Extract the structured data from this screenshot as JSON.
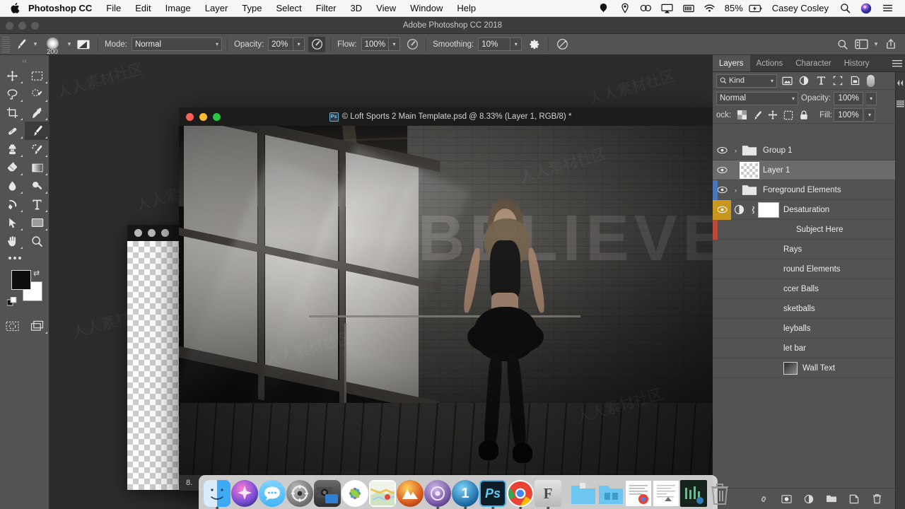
{
  "menubar": {
    "apple_icon": "apple-logo-icon",
    "app_name": "Photoshop CC",
    "items": [
      "File",
      "Edit",
      "Image",
      "Layer",
      "Type",
      "Select",
      "Filter",
      "3D",
      "View",
      "Window",
      "Help"
    ],
    "status_icons": [
      "dropbox-icon",
      "location-icon",
      "creative-cloud-icon",
      "airplay-icon",
      "battery-bar-icon",
      "wifi-icon"
    ],
    "battery": "85%",
    "battery_icon": "battery-charging-icon",
    "user": "Casey Cosley",
    "search_icon": "spotlight-search-icon",
    "siri_icon": "siri-icon",
    "notification_icon": "notification-center-icon"
  },
  "app_title": "Adobe Photoshop CC 2018",
  "optionsbar": {
    "tool_icon": "brush-tool-icon",
    "brush_size": "200",
    "brush_preset_icon": "brush-preset-picker-icon",
    "mode_label": "Mode:",
    "mode_value": "Normal",
    "opacity_label": "Opacity:",
    "opacity_value": "20%",
    "pressure_opacity_icon": "pressure-opacity-icon",
    "flow_label": "Flow:",
    "flow_value": "100%",
    "airbrush_icon": "airbrush-icon",
    "smoothing_label": "Smoothing:",
    "smoothing_value": "10%",
    "smoothing_options_icon": "gear-icon",
    "symmetry_icon": "symmetry-icon",
    "right_icons": [
      "search-icon",
      "workspace-icon",
      "chevron-down-icon",
      "share-icon"
    ]
  },
  "toolbox": {
    "tools": [
      {
        "name": "move-tool",
        "glyph": "move"
      },
      {
        "name": "marquee-tool",
        "glyph": "marquee"
      },
      {
        "name": "lasso-tool",
        "glyph": "lasso"
      },
      {
        "name": "quick-selection-tool",
        "glyph": "quickselect"
      },
      {
        "name": "crop-tool",
        "glyph": "crop"
      },
      {
        "name": "eyedropper-tool",
        "glyph": "eyedropper"
      },
      {
        "name": "healing-brush-tool",
        "glyph": "healing"
      },
      {
        "name": "brush-tool",
        "glyph": "brush",
        "selected": true
      },
      {
        "name": "clone-stamp-tool",
        "glyph": "stamp"
      },
      {
        "name": "history-brush-tool",
        "glyph": "historybrush"
      },
      {
        "name": "eraser-tool",
        "glyph": "eraser"
      },
      {
        "name": "gradient-tool",
        "glyph": "gradient"
      },
      {
        "name": "blur-tool",
        "glyph": "blur"
      },
      {
        "name": "dodge-tool",
        "glyph": "dodge"
      },
      {
        "name": "pen-tool",
        "glyph": "pen"
      },
      {
        "name": "type-tool",
        "glyph": "type"
      },
      {
        "name": "path-selection-tool",
        "glyph": "pathselect"
      },
      {
        "name": "shape-tool",
        "glyph": "shape"
      },
      {
        "name": "hand-tool",
        "glyph": "hand"
      },
      {
        "name": "zoom-tool",
        "glyph": "zoom"
      }
    ],
    "more_tools_icon": "more-tools-icon",
    "foreground_color": "#0d0d0d",
    "background_color": "#ffffff",
    "swap_colors_icon": "swap-colors-icon",
    "default_colors_icon": "default-colors-icon",
    "quick_mask_icon": "quick-mask-icon",
    "screen_mode_icon": "screen-mode-icon"
  },
  "document": {
    "title": "© Loft Sports 2 Main Template.psd @ 8.33% (Layer 1, RGB/8) *",
    "badge": "Ps",
    "zoom_status": "8.",
    "wall_text": "BELIEVE"
  },
  "background_window": {
    "traffic_lights": 3
  },
  "panels": {
    "tabs": [
      {
        "label": "Layers",
        "active": true
      },
      {
        "label": "Actions",
        "active": false
      },
      {
        "label": "Character",
        "active": false
      },
      {
        "label": "History",
        "active": false
      }
    ],
    "menu_icon": "panel-menu-icon",
    "filter": {
      "kind_label": "Kind",
      "search_icon": "search-icon",
      "chevron_icon": "chevron-down-icon",
      "type_filters": [
        "pixel-layer-filter-icon",
        "adjustment-layer-filter-icon",
        "type-layer-filter-icon",
        "shape-layer-filter-icon",
        "smart-object-filter-icon"
      ],
      "toggle_icon": "filter-toggle-switch"
    },
    "blend_mode": "Normal",
    "opacity_label": "Opacity:",
    "opacity_value": "100%",
    "lock_label": "ock:",
    "lock_icons": [
      "lock-transparent-pixels-icon",
      "lock-image-pixels-icon",
      "lock-position-icon",
      "lock-artboard-nesting-icon",
      "lock-all-icon"
    ],
    "fill_label": "Fill:",
    "fill_value": "100%",
    "layers": [
      {
        "name": "Group 1",
        "type": "group",
        "visible": true,
        "selected": false,
        "color": ""
      },
      {
        "name": "Layer 1",
        "type": "pixel",
        "visible": true,
        "selected": true,
        "color": ""
      },
      {
        "name": "Foreground Elements",
        "type": "group",
        "visible": true,
        "selected": false,
        "color": "#4a76b8"
      },
      {
        "name": "Desaturation",
        "type": "adjustment",
        "visible": true,
        "selected": false,
        "color": "#c9971f"
      },
      {
        "name": "Subject Here",
        "type": "group",
        "visible": true,
        "selected": false,
        "color": "#b94b3a"
      },
      {
        "name": "Rays",
        "type": "group",
        "visible": true,
        "selected": false,
        "color": ""
      },
      {
        "name": "round Elements",
        "type": "group",
        "visible": true,
        "selected": false,
        "color": ""
      },
      {
        "name": "ccer Balls",
        "type": "group",
        "visible": true,
        "selected": false,
        "color": ""
      },
      {
        "name": "sketballs",
        "type": "group",
        "visible": true,
        "selected": false,
        "color": ""
      },
      {
        "name": "leyballs",
        "type": "group",
        "visible": true,
        "selected": false,
        "color": ""
      },
      {
        "name": "let bar",
        "type": "group",
        "visible": true,
        "selected": false,
        "color": ""
      },
      {
        "name": "Wall Text",
        "type": "pixel",
        "visible": true,
        "selected": false,
        "color": ""
      }
    ],
    "footer_icons": [
      "link-layers-icon",
      "layer-style-fx-icon",
      "add-layer-mask-icon",
      "new-adjustment-layer-icon",
      "new-group-icon",
      "new-layer-icon",
      "delete-layer-icon"
    ],
    "dock_icons": [
      "collapse-panels-icon",
      "panel-list-icon"
    ]
  },
  "dock": {
    "apps": [
      {
        "name": "finder",
        "label": "",
        "running": true
      },
      {
        "name": "siri",
        "label": "",
        "running": false
      },
      {
        "name": "messages",
        "label": "",
        "running": false
      },
      {
        "name": "system-preferences",
        "label": "",
        "running": false
      },
      {
        "name": "image-capture",
        "label": "",
        "running": false
      },
      {
        "name": "photos",
        "label": "",
        "running": false
      },
      {
        "name": "maps",
        "label": "",
        "running": false
      },
      {
        "name": "mountain-duck",
        "label": "",
        "running": true
      },
      {
        "name": "firefox-dev",
        "label": "",
        "running": true
      },
      {
        "name": "1password",
        "label": "1",
        "running": true
      },
      {
        "name": "photoshop",
        "label": "Ps",
        "running": true
      },
      {
        "name": "chrome",
        "label": "",
        "running": true
      },
      {
        "name": "fontbook",
        "label": "F",
        "running": true
      }
    ],
    "files": [
      {
        "name": "folder-downloads"
      },
      {
        "name": "folder-documents"
      },
      {
        "name": "document-preview-chrome"
      },
      {
        "name": "document-preview-text"
      },
      {
        "name": "document-preview-dark"
      }
    ],
    "trash_icon": "trash-icon"
  },
  "watermark": "人人素材社区"
}
